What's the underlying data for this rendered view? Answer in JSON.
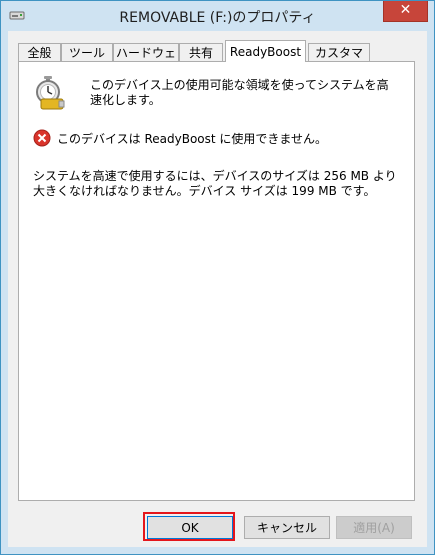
{
  "window": {
    "title": "REMOVABLE (F:)のプロパティ",
    "close_label": "✕"
  },
  "tabs": [
    {
      "label": "全般"
    },
    {
      "label": "ツール"
    },
    {
      "label": "ハードウェア"
    },
    {
      "label": "共有"
    },
    {
      "label": "ReadyBoost",
      "active": true
    },
    {
      "label": "カスタマイズ"
    }
  ],
  "readyboost": {
    "description": "このデバイス上の使用可能な領域を使ってシステムを高速化します。",
    "error": "このデバイスは ReadyBoost に使用できません。",
    "info": "システムを高速で使用するには、デバイスのサイズは 256 MB より大きくなければなりません。デバイス サイズは 199 MB です。"
  },
  "buttons": {
    "ok": "OK",
    "cancel": "キャンセル",
    "apply": "適用(A)"
  },
  "colors": {
    "title_bar": "#cfe3f2",
    "close_button": "#c7453a",
    "highlight": "#e4161c",
    "error_icon": "#d9342b"
  }
}
